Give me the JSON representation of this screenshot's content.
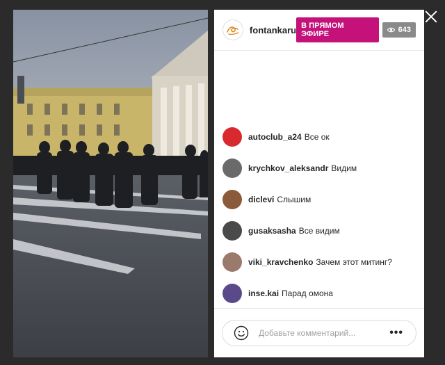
{
  "header": {
    "username": "fontankaru",
    "live_label": "В ПРЯМОМ ЭФИРЕ",
    "view_count": "643"
  },
  "comments": [
    {
      "user": "autoclub_a24",
      "text": "Все ок",
      "avatar_color": "#d8292f"
    },
    {
      "user": "krychkov_aleksandr",
      "text": "Видим",
      "avatar_color": "#6a6a6a"
    },
    {
      "user": "diclevi",
      "text": "Слышим",
      "avatar_color": "#8a5a3a"
    },
    {
      "user": "gusaksasha",
      "text": "Все видим",
      "avatar_color": "#4a4a4a"
    },
    {
      "user": "viki_kravchenko",
      "text": "Зачем этот митинг?",
      "avatar_color": "#9a7a6a"
    },
    {
      "user": "inse.kai",
      "text": "Парад омона",
      "avatar_color": "#5a4a8a"
    }
  ],
  "composer": {
    "placeholder": "Добавьте комментарий...",
    "more_label": "•••"
  },
  "colors": {
    "live_badge": "#c5117a",
    "views_badge": "#8a8a8a",
    "brand_orange": "#e08a1e"
  }
}
